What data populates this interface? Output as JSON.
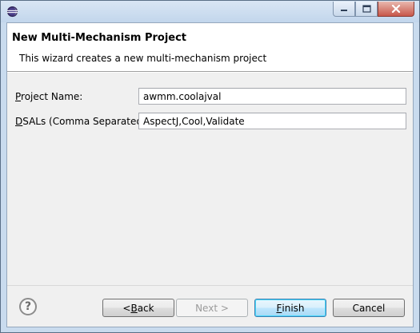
{
  "window": {
    "icon": "eclipse-icon",
    "controls": [
      "minimize-icon",
      "maximize-icon",
      "close-icon"
    ]
  },
  "banner": {
    "title": "New Multi-Mechanism Project",
    "description": "This wizard creates a new multi-mechanism project"
  },
  "form": {
    "project_name_label_mnemonic": "P",
    "project_name_label_rest": "roject Name:",
    "project_name_value": "awmm.coolajval",
    "dsals_label_mnemonic": "D",
    "dsals_label_rest": "SALs (Comma Separated):",
    "dsals_value": "AspectJ,Cool,Validate"
  },
  "footer": {
    "help_glyph": "?",
    "back_prefix": "< ",
    "back_mnemonic": "B",
    "back_rest": "ack",
    "next_label": "Next >",
    "finish_mnemonic": "F",
    "finish_rest": "inish",
    "cancel_label": "Cancel"
  }
}
